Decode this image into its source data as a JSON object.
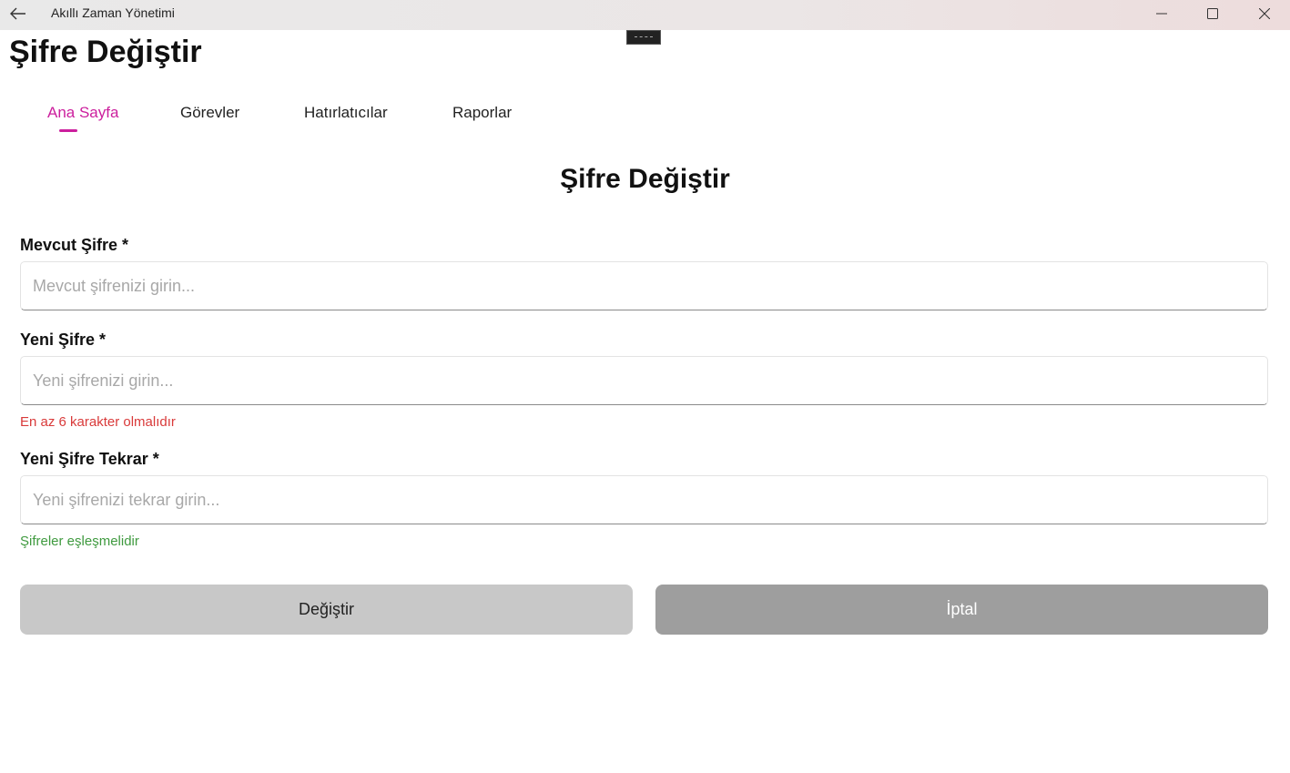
{
  "window": {
    "title": "Akıllı Zaman Yönetimi",
    "icons": {
      "back": "arrow-left-icon",
      "minimize": "minimize-icon",
      "maximize": "maximize-icon",
      "close": "close-icon"
    }
  },
  "header": {
    "page_title": "Şifre Değiştir"
  },
  "tabs": [
    {
      "label": "Ana Sayfa",
      "active": true
    },
    {
      "label": "Görevler",
      "active": false
    },
    {
      "label": "Hatırlatıcılar",
      "active": false
    },
    {
      "label": "Raporlar",
      "active": false
    }
  ],
  "form": {
    "title": "Şifre Değiştir",
    "current_password": {
      "label": "Mevcut Şifre *",
      "value": "",
      "placeholder": "Mevcut şifrenizi girin..."
    },
    "new_password": {
      "label": "Yeni Şifre *",
      "value": "",
      "placeholder": "Yeni şifrenizi girin...",
      "hint": "En az 6 karakter olmalıdır"
    },
    "confirm_password": {
      "label": "Yeni Şifre Tekrar *",
      "value": "",
      "placeholder": "Yeni şifrenizi tekrar girin...",
      "hint": "Şifreler eşleşmelidir"
    },
    "buttons": {
      "change_label": "Değiştir",
      "cancel_label": "İptal"
    }
  },
  "colors": {
    "accent": "#cc1f9d",
    "error": "#d93a3a",
    "success": "#3f9a3f",
    "button_primary": "#c8c8c8",
    "button_secondary": "#9e9e9e"
  }
}
